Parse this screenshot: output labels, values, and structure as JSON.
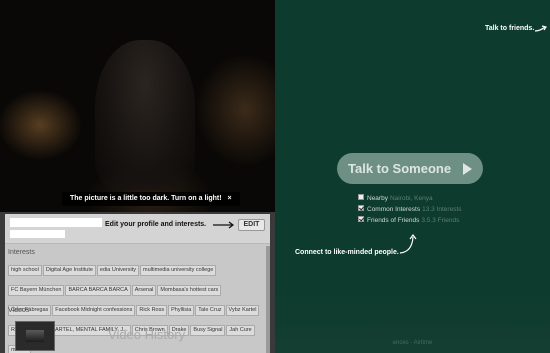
{
  "camera": {
    "warning": "The picture is a little too dark. Turn on a light!",
    "warning_close": "×"
  },
  "profile": {
    "edit_hint": "Edit your profile and interests.",
    "edit_button": "EDIT",
    "interests_label": "Interests",
    "interests": [
      "high school",
      "Digital Age Institute",
      "edia University",
      "multimedia university college",
      "FC Bayern München",
      "BARCA BARCA BARCA",
      "Arsenal",
      "Mombasa's hottest cars",
      "Cesc Fàbregas",
      "Facebook Midnight confessions",
      "Rick Ross",
      "Phyllisia",
      "Tale Cruz",
      "Vybz Kartel",
      "Rubbin",
      "VYBZ KARTEL, MENTAL FAMILY, J...",
      "Chris Brown",
      "Drake",
      "Busy Signal",
      "Jah Cure",
      "more..."
    ],
    "videos_label": "Videos",
    "video_history": "Video History"
  },
  "main": {
    "talk_to_friends": "Talk to friends.",
    "talk_button": "Talk to Someone",
    "options": [
      {
        "label": "Nearby",
        "sub": "Nairobi, Kenya",
        "checked": false
      },
      {
        "label": "Common Interests",
        "sub": "13.3 Interests",
        "checked": true
      },
      {
        "label": "Friends of Friends",
        "sub": "3.5.3 Friends",
        "checked": true
      }
    ],
    "connect_hint": "Connect to like-minded people.",
    "footer": "ences · Airtime"
  },
  "colors": {
    "right_bg": "#0d3b2d",
    "talk_button_bg": "#6e8f84",
    "profile_bg": "#c8c8c8"
  }
}
